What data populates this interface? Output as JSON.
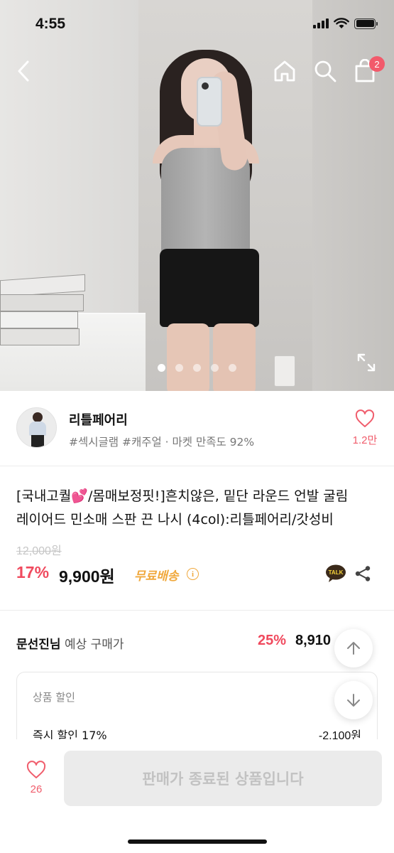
{
  "status_bar": {
    "time": "4:55"
  },
  "nav": {
    "cart_count": "2"
  },
  "gallery": {
    "image_count": 5,
    "active_index": 0
  },
  "seller": {
    "name": "리틀페어리",
    "tags": "#섹시글램 #캐주얼 · 마켓 만족도 92%",
    "likes": "1.2만"
  },
  "product": {
    "title_line1": "[국내고퀄💕/몸매보정핏!]흔치않은, 밑단 라운드 언발 굴림",
    "title_line2": "레이어드 민소매 스판 끈 나시 (4col):리틀페어리/갓성비",
    "original_price": "12,000원",
    "discount_rate": "17%",
    "price": "9,900원",
    "shipping": "무료배송",
    "talk_label": "TALK"
  },
  "expected": {
    "buyer_name": "문선진님",
    "label": " 예상 구매가",
    "discount_rate": "25%",
    "price": "8,910"
  },
  "discount_card": {
    "title": "상품 할인",
    "row_label": "즉시 할인 17%",
    "row_value": "-2,100원"
  },
  "bottom": {
    "like_count": "26",
    "button_label": "판매가 종료된 상품입니다"
  },
  "colors": {
    "accent_red": "#f04a5e",
    "shipping_orange": "#f0a83c",
    "badge_pink": "#f25a6b"
  }
}
